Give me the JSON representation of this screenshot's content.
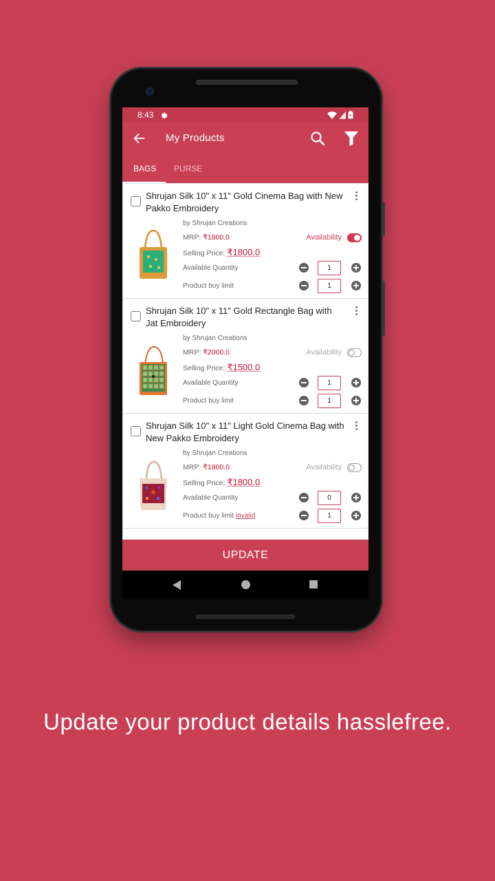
{
  "colors": {
    "background": "#c94055",
    "app_bar": "#c94055",
    "status_bar": "#c0394d",
    "price_red": "#c8102e",
    "toggle_on": "#d6344f"
  },
  "status_bar": {
    "time": "8:43",
    "icons": [
      "gear-icon",
      "wifi-icon",
      "signal-icon",
      "battery-icon"
    ]
  },
  "app_bar": {
    "title": "My Products",
    "back_icon": "arrow-left-icon",
    "search_icon": "search-icon",
    "filter_icon": "filter-icon"
  },
  "tabs": [
    {
      "label": "BAGS",
      "active": true
    },
    {
      "label": "PURSE",
      "active": false
    }
  ],
  "labels": {
    "mrp": "MRP: ",
    "selling_price": "Selling Price: ",
    "available_quantity": "Available Quantity",
    "buy_limit": "Product buy limit",
    "availability": "Availability"
  },
  "products": [
    {
      "title": "Shrujan Silk 10\" x 11\" Gold Cinema Bag with New Pakko Embroidery",
      "vendor": "by Shrujan Creations",
      "mrp": "₹1800.0",
      "selling_price": "₹1800.0",
      "available": true,
      "available_quantity": "1",
      "buy_limit": "1",
      "buy_limit_error": ""
    },
    {
      "title": "Shrujan Silk 10\" x 11\" Gold Rectangle Bag with Jat Embroidery",
      "vendor": "by Shrujan Creations",
      "mrp": "₹2000.0",
      "selling_price": "₹1500.0",
      "available": false,
      "available_quantity": "1",
      "buy_limit": "1",
      "buy_limit_error": ""
    },
    {
      "title": "Shrujan Silk 10\" x 11\" Light Gold Cinema Bag with New Pakko Embroidery",
      "vendor": "by Shrujan Creations",
      "mrp": "₹1800.0",
      "selling_price": "₹1800.0",
      "available": false,
      "available_quantity": "0",
      "buy_limit": "1",
      "buy_limit_error": "invalid"
    }
  ],
  "update_button": "UPDATE",
  "tagline": "Update your product details hasslefree."
}
